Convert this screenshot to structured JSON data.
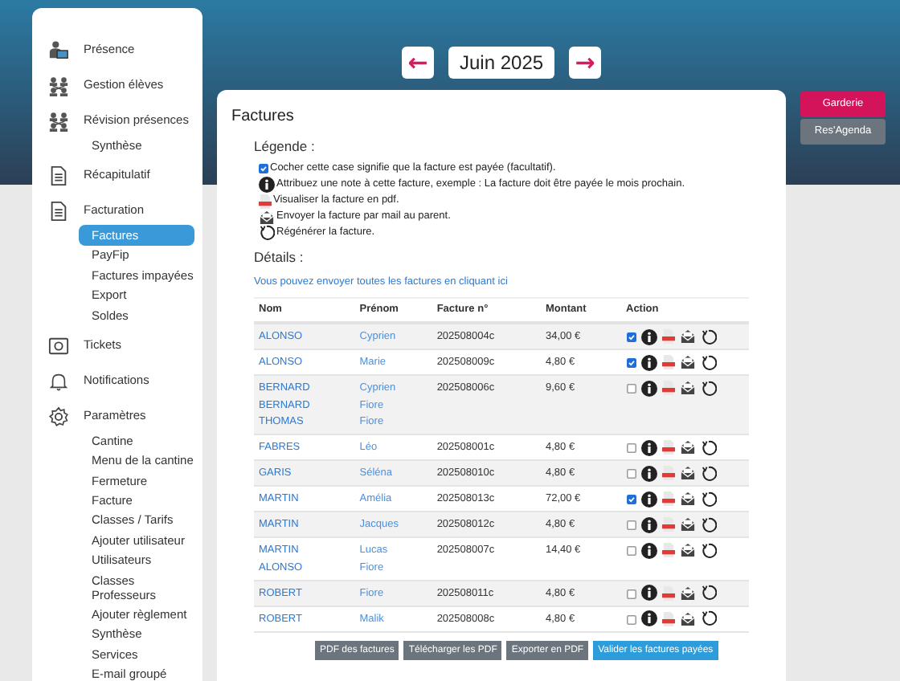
{
  "month_nav": {
    "prev": "←",
    "month": "Juin 2025",
    "next": "→"
  },
  "sidebar": {
    "items": [
      {
        "label": "Présence",
        "selected": false
      },
      {
        "label": "Gestion élèves",
        "selected": false
      },
      {
        "label": "Révision présences",
        "selected": false,
        "children": [
          {
            "label": "Synthèse",
            "selected": false
          }
        ]
      },
      {
        "label": "Récapitulatif",
        "selected": false
      },
      {
        "label": "Facturation",
        "selected": false,
        "children": [
          {
            "label": "Factures",
            "selected": true
          },
          {
            "label": "PayFip",
            "selected": false
          },
          {
            "label": "Factures impayées",
            "selected": false
          },
          {
            "label": "Export",
            "selected": false
          },
          {
            "label": "Soldes",
            "selected": false
          }
        ]
      },
      {
        "label": "Tickets",
        "selected": false
      },
      {
        "label": "Notifications",
        "selected": false
      },
      {
        "label": "Paramètres",
        "selected": false,
        "children": [
          {
            "label": "Cantine",
            "selected": false
          },
          {
            "label": "Menu de la cantine",
            "selected": false
          },
          {
            "label": "Fermeture",
            "selected": false
          },
          {
            "label": "Facture",
            "selected": false
          },
          {
            "label": "Classes / Tarifs",
            "selected": false
          },
          {
            "label": "Ajouter utilisateur",
            "selected": false
          },
          {
            "label": "Utilisateurs",
            "selected": false
          },
          {
            "label": "Classes Professeurs",
            "selected": false
          },
          {
            "label": "Ajouter règlement",
            "selected": false
          },
          {
            "label": "Synthèse",
            "selected": false
          },
          {
            "label": "Services",
            "selected": false
          },
          {
            "label": "E-mail groupé",
            "selected": false
          }
        ]
      }
    ]
  },
  "panel": {
    "title": "Factures",
    "legend_title": "Légende :",
    "legend": [
      {
        "kind": "checkbox",
        "text": "Cocher cette case signifie que la facture est payée (facultatif)."
      },
      {
        "kind": "info",
        "text": "Attribuez une note à cette facture, exemple : La facture doit être payée le mois prochain."
      },
      {
        "kind": "pdf",
        "text": "Visualiser la facture en pdf."
      },
      {
        "kind": "mail",
        "text": "Envoyer la facture par mail au parent."
      },
      {
        "kind": "regen",
        "text": "Régénérer la facture."
      }
    ],
    "details_title": "Détails :",
    "send_all_link": "Vous pouvez envoyer toutes les factures en cliquant ici",
    "table": {
      "columns": [
        "Nom",
        "Prénom",
        "Facture n°",
        "Montant",
        "Action"
      ],
      "rows": [
        {
          "noms": [
            "ALONSO"
          ],
          "prenoms": [
            "Cyprien"
          ],
          "facture": "202508004c",
          "montant": "34,00 €",
          "paid": true
        },
        {
          "noms": [
            "ALONSO"
          ],
          "prenoms": [
            "Marie"
          ],
          "facture": "202508009c",
          "montant": "4,80 €",
          "paid": true
        },
        {
          "noms": [
            "BERNARD",
            "BERNARD",
            "THOMAS"
          ],
          "prenoms": [
            "Cyprien",
            "Fiore",
            "Fiore"
          ],
          "facture": "202508006c",
          "montant": "9,60 €",
          "paid": false
        },
        {
          "noms": [
            "FABRES"
          ],
          "prenoms": [
            "Léo"
          ],
          "facture": "202508001c",
          "montant": "4,80 €",
          "paid": false
        },
        {
          "noms": [
            "GARIS"
          ],
          "prenoms": [
            "Séléna"
          ],
          "facture": "202508010c",
          "montant": "4,80 €",
          "paid": false
        },
        {
          "noms": [
            "MARTIN"
          ],
          "prenoms": [
            "Amélia"
          ],
          "facture": "202508013c",
          "montant": "72,00 €",
          "paid": true
        },
        {
          "noms": [
            "MARTIN"
          ],
          "prenoms": [
            "Jacques"
          ],
          "facture": "202508012c",
          "montant": "4,80 €",
          "paid": false
        },
        {
          "noms": [
            "MARTIN",
            "ALONSO"
          ],
          "prenoms": [
            "Lucas",
            "Fiore"
          ],
          "facture": "202508007c",
          "montant": "14,40 €",
          "paid": false
        },
        {
          "noms": [
            "ROBERT"
          ],
          "prenoms": [
            "Fiore"
          ],
          "facture": "202508011c",
          "montant": "4,80 €",
          "paid": false
        },
        {
          "noms": [
            "ROBERT"
          ],
          "prenoms": [
            "Malik"
          ],
          "facture": "202508008c",
          "montant": "4,80 €",
          "paid": false
        }
      ]
    },
    "buttons": [
      {
        "label": "PDF des factures",
        "kind": "secondary"
      },
      {
        "label": "Télécharger les PDF",
        "kind": "secondary"
      },
      {
        "label": "Exporter en PDF",
        "kind": "secondary"
      },
      {
        "label": "Valider les factures payées",
        "kind": "primary"
      }
    ]
  },
  "side_buttons": [
    {
      "label": "Garderie",
      "kind": "accent"
    },
    {
      "label": "Res'Agenda",
      "kind": "secondary"
    }
  ]
}
